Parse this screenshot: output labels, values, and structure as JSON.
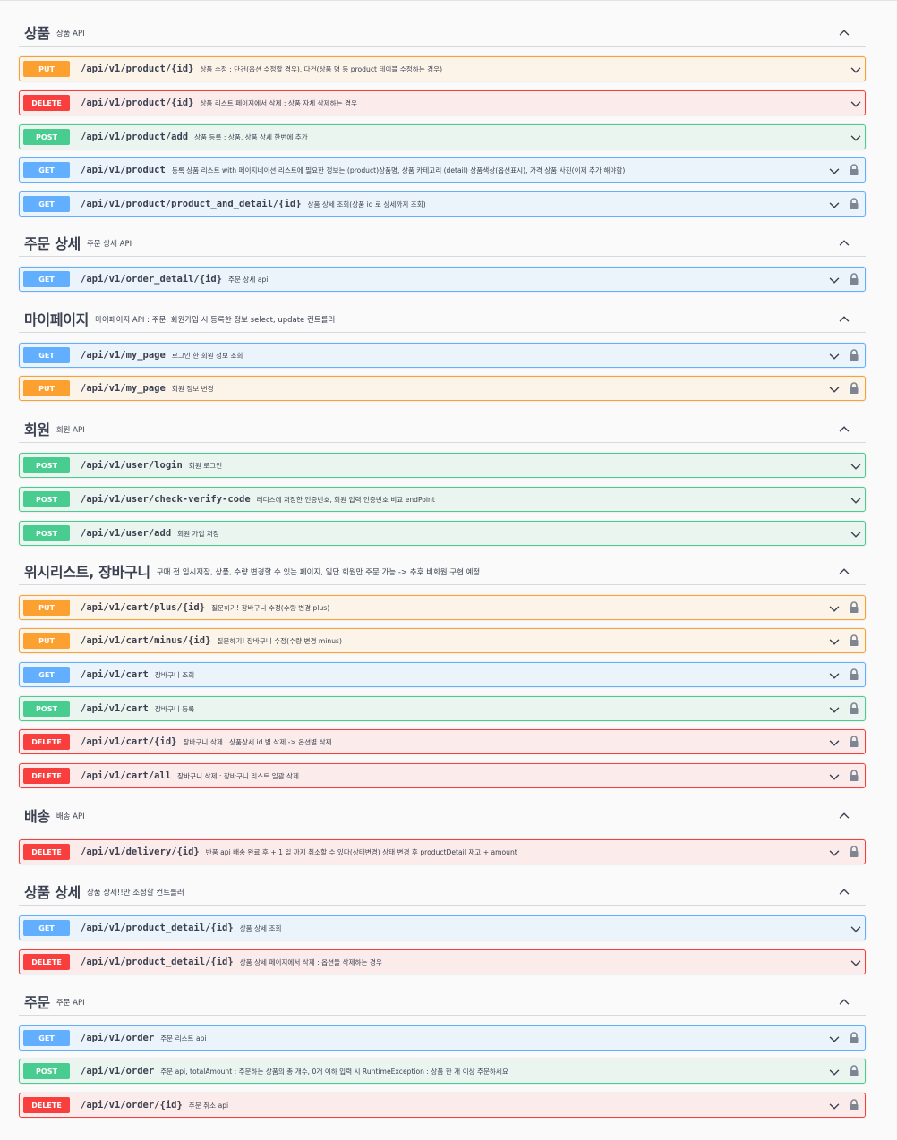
{
  "colors": {
    "put": "#fca130",
    "delete": "#f93e3e",
    "post": "#49cc90",
    "get": "#61affe"
  },
  "sections": [
    {
      "title": "상품",
      "desc": "상품 API",
      "ops": [
        {
          "method": "PUT",
          "path": "/api/v1/product/{id}",
          "summary": "상품 수정 : 단건(옵션 수정할 경우), 다건(상품 명 등 product 테이블 수정하는 경우)",
          "locked": false
        },
        {
          "method": "DELETE",
          "path": "/api/v1/product/{id}",
          "summary": "상품 리스트 페이지에서 삭제 : 상품 자체 삭제하는 경우",
          "locked": false
        },
        {
          "method": "POST",
          "path": "/api/v1/product/add",
          "summary": "상품 등록 : 상품, 상품 상세 한번에 추가",
          "locked": false
        },
        {
          "method": "GET",
          "path": "/api/v1/product",
          "summary": "등록 상품 리스트 with 페이지네이션 리스트에 필요한 정보는 (product)상품명, 상품 카테고리 (detail) 상품색상(옵션표시), 가격 상품 사진(이제 추가 해야함)",
          "locked": true
        },
        {
          "method": "GET",
          "path": "/api/v1/product/product_and_detail/{id}",
          "summary": "상품 상세 조회(상품 id 로 상세까지 조회)",
          "locked": true
        }
      ]
    },
    {
      "title": "주문 상세",
      "desc": "주문 상세 API",
      "ops": [
        {
          "method": "GET",
          "path": "/api/v1/order_detail/{id}",
          "summary": "주문 상세 api",
          "locked": true
        }
      ]
    },
    {
      "title": "마이페이지",
      "desc": "마이페이지 API : 주문, 회원가입 시 등록한 정보 select, update 컨트롤러",
      "ops": [
        {
          "method": "GET",
          "path": "/api/v1/my_page",
          "summary": "로그인 한 회원 정보 조회",
          "locked": true
        },
        {
          "method": "PUT",
          "path": "/api/v1/my_page",
          "summary": "회원 정보 변경",
          "locked": true
        }
      ]
    },
    {
      "title": "회원",
      "desc": "회원 API",
      "ops": [
        {
          "method": "POST",
          "path": "/api/v1/user/login",
          "summary": "회원 로그인",
          "locked": false
        },
        {
          "method": "POST",
          "path": "/api/v1/user/check-verify-code",
          "summary": "레디스에 저장한 인증번호, 회원 입력 인증번호 비교 endPoint",
          "locked": false
        },
        {
          "method": "POST",
          "path": "/api/v1/user/add",
          "summary": "회원 가입 저장",
          "locked": false
        }
      ]
    },
    {
      "title": "위시리스트, 장바구니",
      "desc": "구매 전 임시저장, 상품, 수량 변경할 수 있는 페이지, 일단 회원만 주문 가능 -> 추후 비회원 구현 예정",
      "ops": [
        {
          "method": "PUT",
          "path": "/api/v1/cart/plus/{id}",
          "summary": "질문하기! 장바구니 수정(수량 변경 plus)",
          "locked": true
        },
        {
          "method": "PUT",
          "path": "/api/v1/cart/minus/{id}",
          "summary": "질문하기! 장바구니 수정(수량 변경 minus)",
          "locked": true
        },
        {
          "method": "GET",
          "path": "/api/v1/cart",
          "summary": "장바구니 조회",
          "locked": true
        },
        {
          "method": "POST",
          "path": "/api/v1/cart",
          "summary": "장바구니 등록",
          "locked": true
        },
        {
          "method": "DELETE",
          "path": "/api/v1/cart/{id}",
          "summary": "장바구니 삭제 : 상품상세 id 별 삭제 -> 옵션별 삭제",
          "locked": true
        },
        {
          "method": "DELETE",
          "path": "/api/v1/cart/all",
          "summary": "장바구니 삭제 : 장바구니 리스트 일괄 삭제",
          "locked": true
        }
      ]
    },
    {
      "title": "배송",
      "desc": "배송 API",
      "ops": [
        {
          "method": "DELETE",
          "path": "/api/v1/delivery/{id}",
          "summary": "반품 api 배송 완료 후 + 1 일 까지 취소할 수 있다(상태변경) 상태 변경 후 productDetail 재고 + amount",
          "locked": true
        }
      ]
    },
    {
      "title": "상품 상세",
      "desc": "상품 상세!!만 조정할 컨트롤러",
      "ops": [
        {
          "method": "GET",
          "path": "/api/v1/product_detail/{id}",
          "summary": "상품 상세 조회",
          "locked": false
        },
        {
          "method": "DELETE",
          "path": "/api/v1/product_detail/{id}",
          "summary": "상품 상세 페이지에서 삭제 : 옵션들 삭제하는 경우",
          "locked": false
        }
      ]
    },
    {
      "title": "주문",
      "desc": "주문 API",
      "ops": [
        {
          "method": "GET",
          "path": "/api/v1/order",
          "summary": "주문 리스트 api",
          "locked": true
        },
        {
          "method": "POST",
          "path": "/api/v1/order",
          "summary": "주문 api, totalAmount : 주문하는 상품의 총 개수, 0개 이하 입력 시 RuntimeException : 상품 한 개 이상 주문하세요",
          "locked": true
        },
        {
          "method": "DELETE",
          "path": "/api/v1/order/{id}",
          "summary": "주문 취소 api",
          "locked": true
        }
      ]
    }
  ]
}
